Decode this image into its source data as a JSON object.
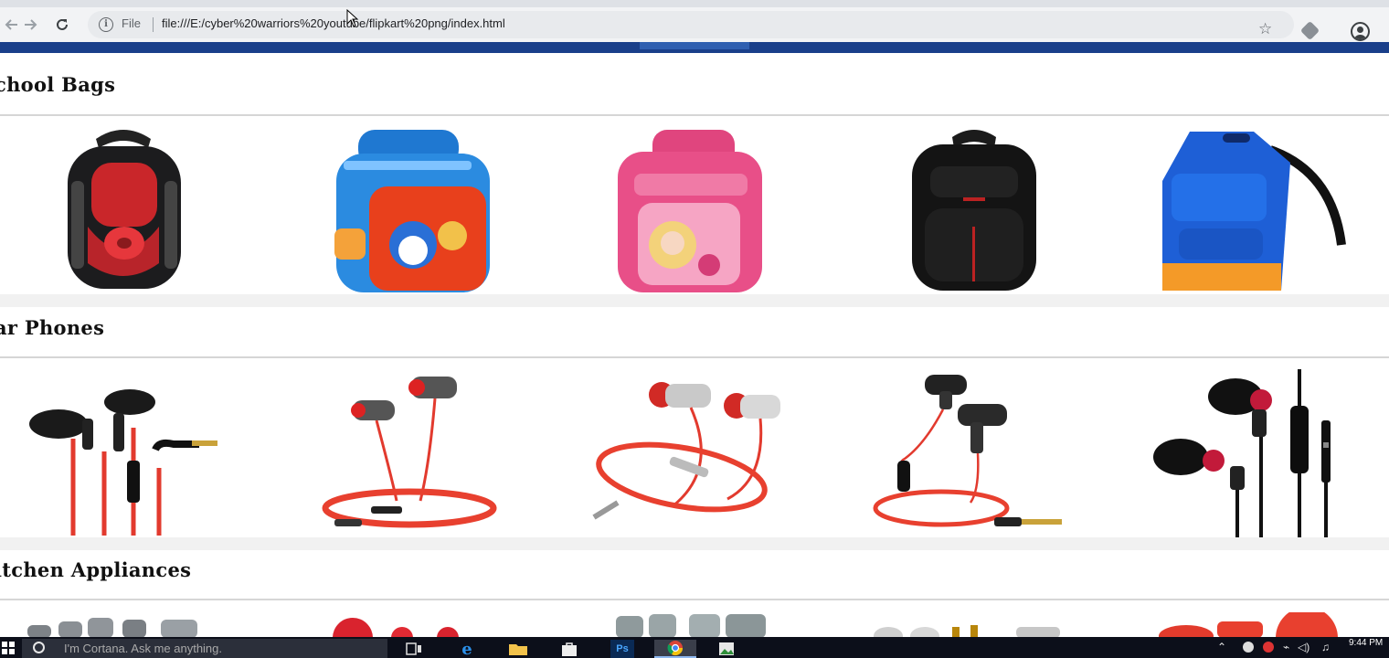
{
  "browser": {
    "url_scheme": "File",
    "url": "file:///E:/cyber%20warriors%20youtube/flipkart%20png/index.html",
    "back_icon": "back-arrow-icon",
    "forward_icon": "forward-arrow-icon",
    "reload_icon": "reload-icon"
  },
  "sections": [
    {
      "title": "chool Bags",
      "items": [
        "red-black backpack",
        "blue cartoon backpack",
        "pink princess backpack",
        "black backpack",
        "blue-orange backpack"
      ]
    },
    {
      "title": "ar Phones",
      "items": [
        "black-red earphones",
        "red cable earphones",
        "silver-red earphones",
        "black-red coiled earphones",
        "black-red earphones with mic"
      ]
    },
    {
      "title": "itchen Appliances",
      "items": [
        "gray utensils",
        "red sieves",
        "gray spatulas",
        "silver utensils",
        "red kitchen set"
      ]
    }
  ],
  "taskbar": {
    "search_placeholder": "I'm Cortana. Ask me anything.",
    "time": "9:44 PM"
  }
}
